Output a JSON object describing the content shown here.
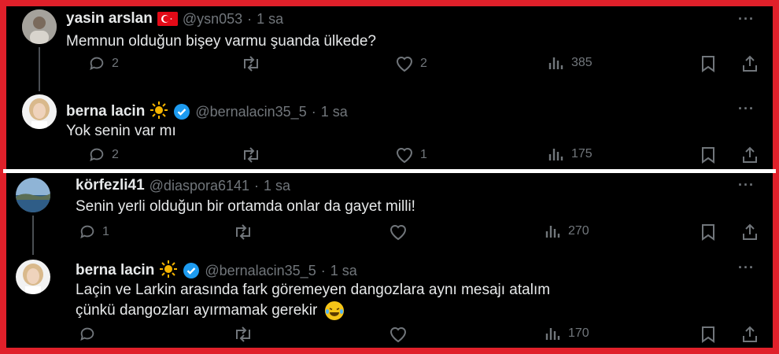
{
  "thread": [
    {
      "name": "yasin arslan",
      "handle": "@ysn053",
      "time": "1 sa",
      "flag_icon": "turkey-flag-icon",
      "verified": false,
      "text_lines": [
        "Memnun olduğun bişey varmu şuanda ülkede?"
      ],
      "replies": "2",
      "reposts": "",
      "likes": "2",
      "views": "385"
    },
    {
      "name": "berna lacin",
      "handle": "@bernalacin35_5",
      "time": "1 sa",
      "emoji_icon": "sun-icon",
      "verified": true,
      "text_lines": [
        "Yok senin var mı"
      ],
      "replies": "2",
      "reposts": "",
      "likes": "1",
      "views": "175"
    },
    {
      "name": "körfezli41",
      "handle": "@diaspora6141",
      "time": "1 sa",
      "verified": false,
      "text_lines": [
        "Senin yerli olduğun bir ortamda onlar da gayet milli!"
      ],
      "replies": "1",
      "reposts": "",
      "likes": "",
      "views": "270"
    },
    {
      "name": "berna lacin",
      "handle": "@bernalacin35_5",
      "time": "1 sa",
      "emoji_icon": "sun-icon",
      "verified": true,
      "text_lines": [
        "Laçin ve Larkin arasında fark göremeyen dangozlara aynı mesajı atalım",
        "çünkü dangozları ayırmamak gerekir"
      ],
      "trailing_emoji": "laughing-tears-emoji-icon",
      "replies": "",
      "reposts": "",
      "likes": "",
      "views": "170"
    }
  ],
  "separator": "·",
  "more_label": "···",
  "colors": {
    "background": "#000000",
    "frame": "#e0202a",
    "text_primary": "#e7e9ea",
    "text_secondary": "#71767b",
    "verified_blue": "#1d9bf0",
    "thread_line": "#4a4e53"
  }
}
